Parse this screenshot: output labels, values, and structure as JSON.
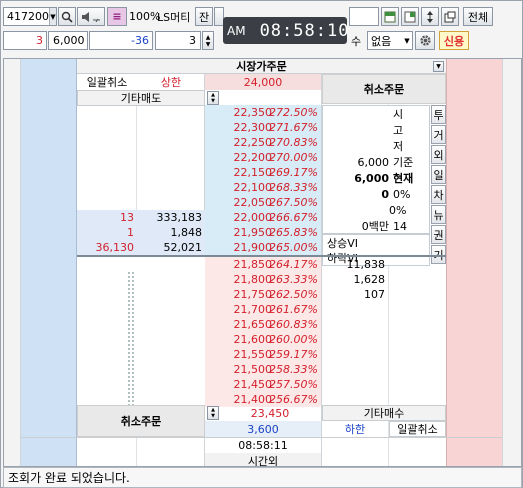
{
  "toolbar1": {
    "stock_code": "417200",
    "zoom": "100%",
    "broker": "LS머티",
    "btn_balance": "잔",
    "btn_all": "전체"
  },
  "clock": {
    "ampm": "AM",
    "time": "08:58:10"
  },
  "toolbar2": {
    "qty_small": "3",
    "qty_value": "6,000",
    "diff": "-36",
    "spin_value": "3",
    "suffix_su": "수",
    "option": "없음",
    "credit_btn": "신용"
  },
  "header": {
    "market_label": "시장가주문",
    "cancel_all": "일괄취소",
    "upper_limit_label": "상한",
    "upper_limit_price": "24,000",
    "cancel_order_top": "취소주문",
    "other_sell": "기타매도"
  },
  "asks": [
    {
      "price": "22,350",
      "rate": "272.50%",
      "qty": "",
      "cnt": ""
    },
    {
      "price": "22,300",
      "rate": "271.67%",
      "qty": "",
      "cnt": ""
    },
    {
      "price": "22,250",
      "rate": "270.83%",
      "qty": "",
      "cnt": ""
    },
    {
      "price": "22,200",
      "rate": "270.00%",
      "qty": "",
      "cnt": ""
    },
    {
      "price": "22,150",
      "rate": "269.17%",
      "qty": "",
      "cnt": ""
    },
    {
      "price": "22,100",
      "rate": "268.33%",
      "qty": "",
      "cnt": ""
    },
    {
      "price": "22,050",
      "rate": "267.50%",
      "qty": "",
      "cnt": ""
    },
    {
      "price": "22,000",
      "rate": "266.67%",
      "qty": "333,183",
      "cnt": "13"
    },
    {
      "price": "21,950",
      "rate": "265.83%",
      "qty": "1,848",
      "cnt": "1"
    },
    {
      "price": "21,900",
      "rate": "265.00%",
      "qty": "52,021",
      "cnt": "36,130"
    }
  ],
  "bids": [
    {
      "price": "21,850",
      "rate": "264.17%",
      "qty": "11,838"
    },
    {
      "price": "21,800",
      "rate": "263.33%",
      "qty": "1,628"
    },
    {
      "price": "21,750",
      "rate": "262.50%",
      "qty": "107"
    },
    {
      "price": "21,700",
      "rate": "261.67%",
      "qty": ""
    },
    {
      "price": "21,650",
      "rate": "260.83%",
      "qty": ""
    },
    {
      "price": "21,600",
      "rate": "260.00%",
      "qty": ""
    },
    {
      "price": "21,550",
      "rate": "259.17%",
      "qty": ""
    },
    {
      "price": "21,500",
      "rate": "258.33%",
      "qty": ""
    },
    {
      "price": "21,450",
      "rate": "257.50%",
      "qty": ""
    },
    {
      "price": "21,400",
      "rate": "256.67%",
      "qty": ""
    }
  ],
  "info": {
    "open": "시",
    "high": "고",
    "low": "저",
    "base_value": "6,000",
    "base_label": "기준",
    "current_value": "6,000",
    "current_label": "현재",
    "zero": "0",
    "pct1": "0%",
    "pct2": "0%",
    "million": "0백만",
    "fourteen": "14",
    "vi_up": "상승VI",
    "vi_down": "하락VI"
  },
  "side_tabs": [
    "투",
    "거",
    "외",
    "일",
    "차",
    "뉴",
    "권",
    "기"
  ],
  "footer": {
    "cancel_order_bottom": "취소주문",
    "lower_limit_price_red": "23,450",
    "lower_limit_price": "3,600",
    "lower_limit_label": "하한",
    "other_buy": "기타매수",
    "cancel_all_bottom": "일괄취소",
    "time": "08:58:11",
    "after_hours": "시간외"
  },
  "status": "조회가 완료 되었습니다.",
  "colors": {
    "ask_blue_col": "#cfe1f5",
    "bid_pink_col": "#f8d4d4",
    "price_highlight": "#d7ecf6",
    "rate_red": "#d3202b",
    "credit_red": "#e03030"
  }
}
